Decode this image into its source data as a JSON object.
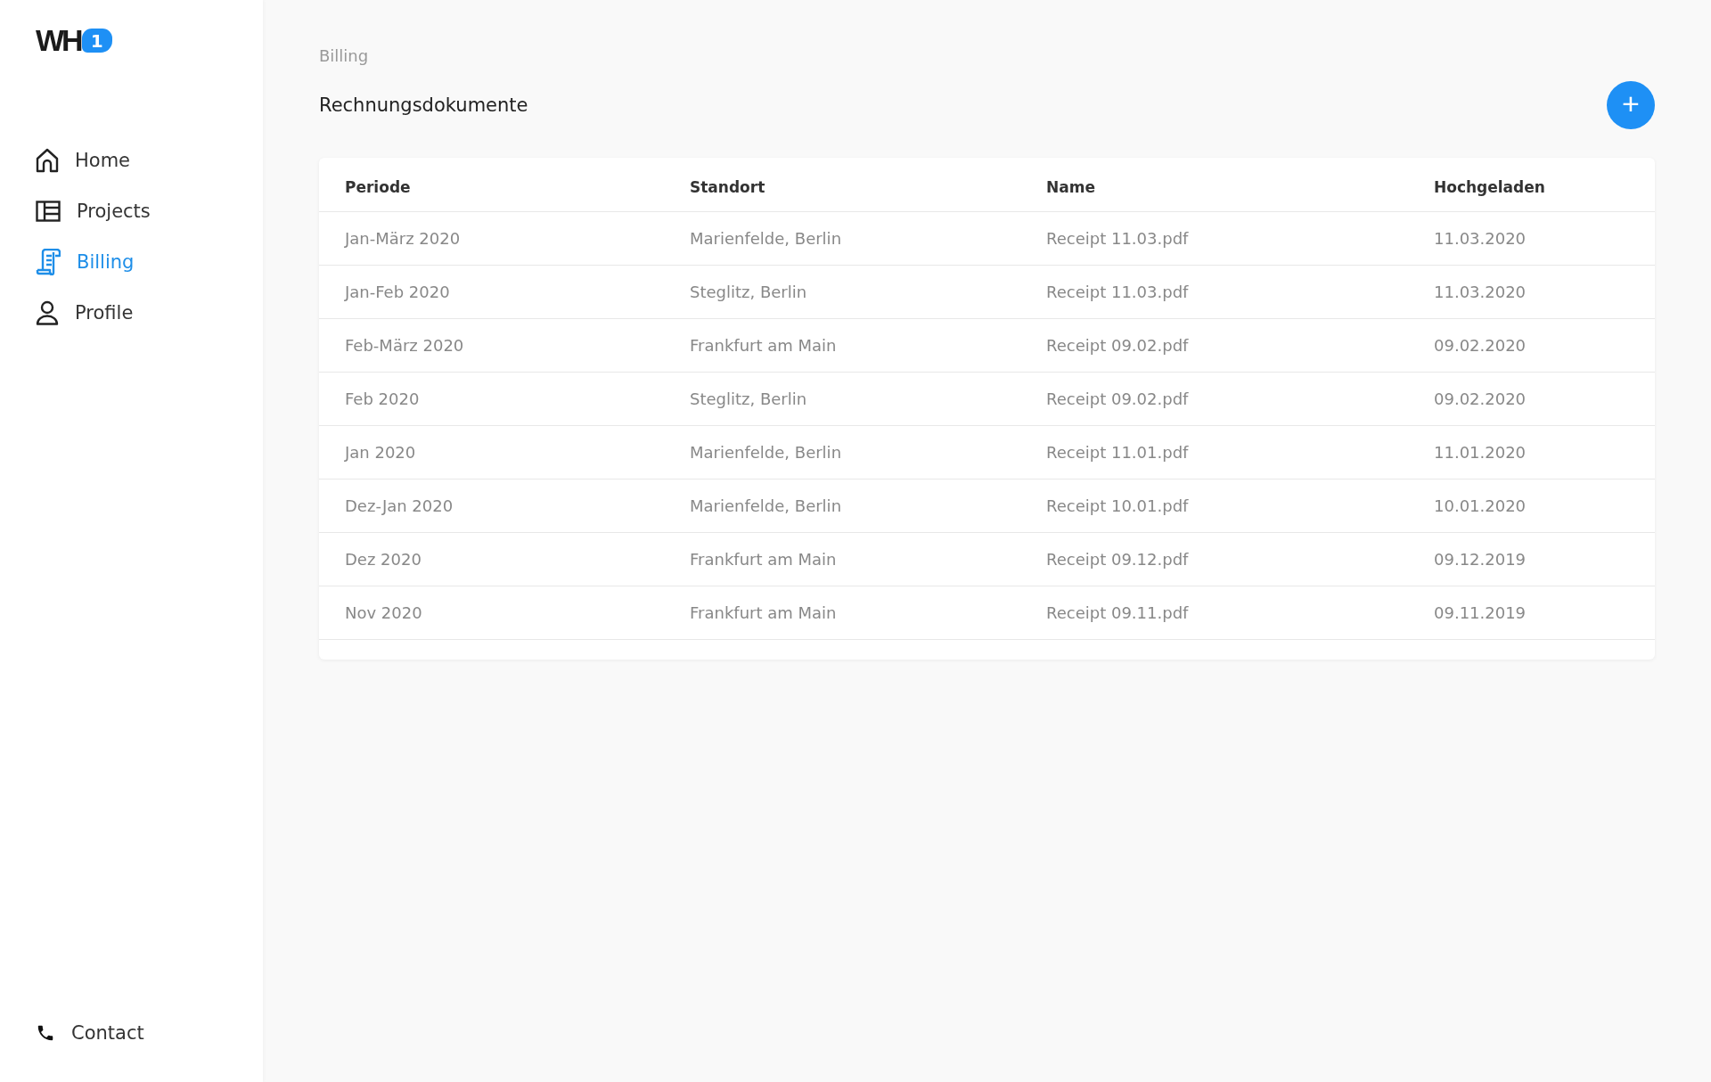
{
  "logo": {
    "text": "WH",
    "badge": "1"
  },
  "nav": [
    {
      "label": "Home",
      "selected": false
    },
    {
      "label": "Projects",
      "selected": false
    },
    {
      "label": "Billing",
      "selected": true
    },
    {
      "label": "Profile",
      "selected": false
    }
  ],
  "contact": {
    "label": "Contact"
  },
  "breadcrumb": "Billing",
  "title": "Rechnungsdokumente",
  "add_button": "+",
  "table": {
    "columns": [
      "Periode",
      "Standort",
      "Name",
      "Hochgeladen"
    ],
    "rows": [
      [
        "Jan-März 2020",
        "Marienfelde, Berlin",
        "Receipt 11.03.pdf",
        "11.03.2020"
      ],
      [
        "Jan-Feb 2020",
        "Steglitz, Berlin",
        "Receipt 11.03.pdf",
        "11.03.2020"
      ],
      [
        "Feb-März 2020",
        "Frankfurt am Main",
        "Receipt 09.02.pdf",
        "09.02.2020"
      ],
      [
        "Feb 2020",
        "Steglitz, Berlin",
        "Receipt 09.02.pdf",
        "09.02.2020"
      ],
      [
        "Jan 2020",
        "Marienfelde, Berlin",
        "Receipt 11.01.pdf",
        "11.01.2020"
      ],
      [
        "Dez-Jan 2020",
        "Marienfelde, Berlin",
        "Receipt 10.01.pdf",
        "10.01.2020"
      ],
      [
        "Dez 2020",
        "Frankfurt am Main",
        "Receipt 09.12.pdf",
        "09.12.2019"
      ],
      [
        "Nov 2020",
        "Frankfurt am Main",
        "Receipt 09.11.pdf",
        "09.11.2019"
      ]
    ]
  }
}
